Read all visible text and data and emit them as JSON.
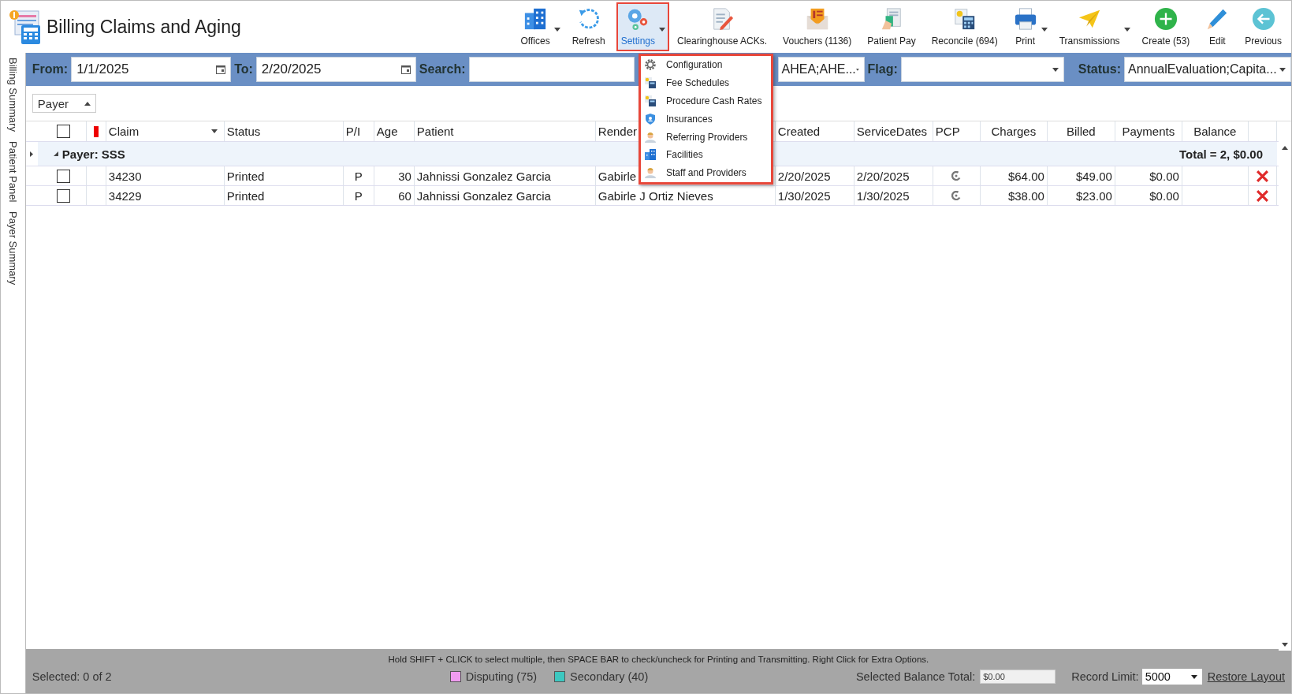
{
  "app": {
    "title": "Billing Claims and Aging"
  },
  "toolbar": [
    {
      "label": "Offices",
      "dropdown": true,
      "selected": false
    },
    {
      "label": "Refresh",
      "dropdown": false,
      "selected": false
    },
    {
      "label": "Settings",
      "dropdown": true,
      "selected": true
    },
    {
      "label": "Clearinghouse ACKs.",
      "dropdown": false,
      "selected": false
    },
    {
      "label": "Vouchers (1136)",
      "dropdown": false,
      "selected": false
    },
    {
      "label": "Patient Pay",
      "dropdown": false,
      "selected": false
    },
    {
      "label": "Reconcile (694)",
      "dropdown": false,
      "selected": false
    },
    {
      "label": "Print",
      "dropdown": true,
      "selected": false
    },
    {
      "label": "Transmissions",
      "dropdown": true,
      "selected": false
    },
    {
      "label": "Create (53)",
      "dropdown": false,
      "selected": false
    },
    {
      "label": "Edit",
      "dropdown": false,
      "selected": false
    },
    {
      "label": "Previous",
      "dropdown": false,
      "selected": false
    }
  ],
  "settings_menu": [
    {
      "label": "Configuration"
    },
    {
      "label": "Fee Schedules"
    },
    {
      "label": "Procedure Cash Rates"
    },
    {
      "label": "Insurances"
    },
    {
      "label": "Referring Providers"
    },
    {
      "label": "Facilities"
    },
    {
      "label": "Staff and Providers"
    }
  ],
  "side_tabs": [
    {
      "label": "Billing Summary"
    },
    {
      "label": "Patient Panel"
    },
    {
      "label": "Payer Summary"
    }
  ],
  "filters": {
    "from_label": "From:",
    "from": "1/1/2025",
    "to_label": "To:",
    "to": "2/20/2025",
    "search_label": "Search:",
    "combo_value": "AHEA;AHE...",
    "flag_label": "Flag:",
    "status_label": "Status:",
    "status": "AnnualEvaluation;Capita..."
  },
  "group_panel": {
    "label": "Payer"
  },
  "table": {
    "header_checkbox": {
      "checked": false
    },
    "columns": [
      {
        "label": "Claim",
        "kind": "text"
      },
      {
        "label": "Status",
        "kind": "text"
      },
      {
        "label": "P/I",
        "kind": "text"
      },
      {
        "label": "Age",
        "kind": "text"
      },
      {
        "label": "Patient",
        "kind": "text"
      },
      {
        "label": "Render",
        "kind": "text"
      },
      {
        "label": "Created",
        "kind": "text"
      },
      {
        "label": "ServiceDates",
        "kind": "text"
      },
      {
        "label": "PCP",
        "kind": "icon"
      },
      {
        "label": "Charges",
        "kind": "text"
      },
      {
        "label": "Billed",
        "kind": "text"
      },
      {
        "label": "Payments",
        "kind": "text"
      },
      {
        "label": "Balance",
        "kind": "empty"
      }
    ],
    "group": {
      "label": "Payer: SSS",
      "total": "Total = 2,  $0.00",
      "expanded": true
    },
    "rows": [
      {
        "checked": false,
        "cells": [
          "34230",
          "Printed",
          "P",
          "30",
          "Jahnissi Gonzalez Garcia",
          "Gabirle",
          "2/20/2025",
          "2/20/2025",
          "",
          "$64.00",
          "$49.00",
          "$0.00",
          ""
        ]
      },
      {
        "checked": false,
        "cells": [
          "34229",
          "Printed",
          "P",
          "60",
          "Jahnissi Gonzalez Garcia",
          "Gabirle J Ortiz Nieves",
          "1/30/2025",
          "1/30/2025",
          "",
          "$38.00",
          "$23.00",
          "$0.00",
          ""
        ]
      }
    ]
  },
  "footer": {
    "hint": "Hold SHIFT + CLICK to select multiple, then SPACE BAR to check/uncheck for Printing and Transmitting. Right Click for Extra Options.",
    "selected": "Selected: 0 of 2",
    "legend": [
      {
        "label": "Disputing (75)",
        "color": "#ef9cef"
      },
      {
        "label": "Secondary (40)",
        "color": "#3cc8c0"
      }
    ],
    "balance_label": "Selected Balance Total:",
    "balance_value": "$0.00",
    "record_label": "Record Limit:",
    "record_value": "5000",
    "restore": "Restore Layout"
  }
}
